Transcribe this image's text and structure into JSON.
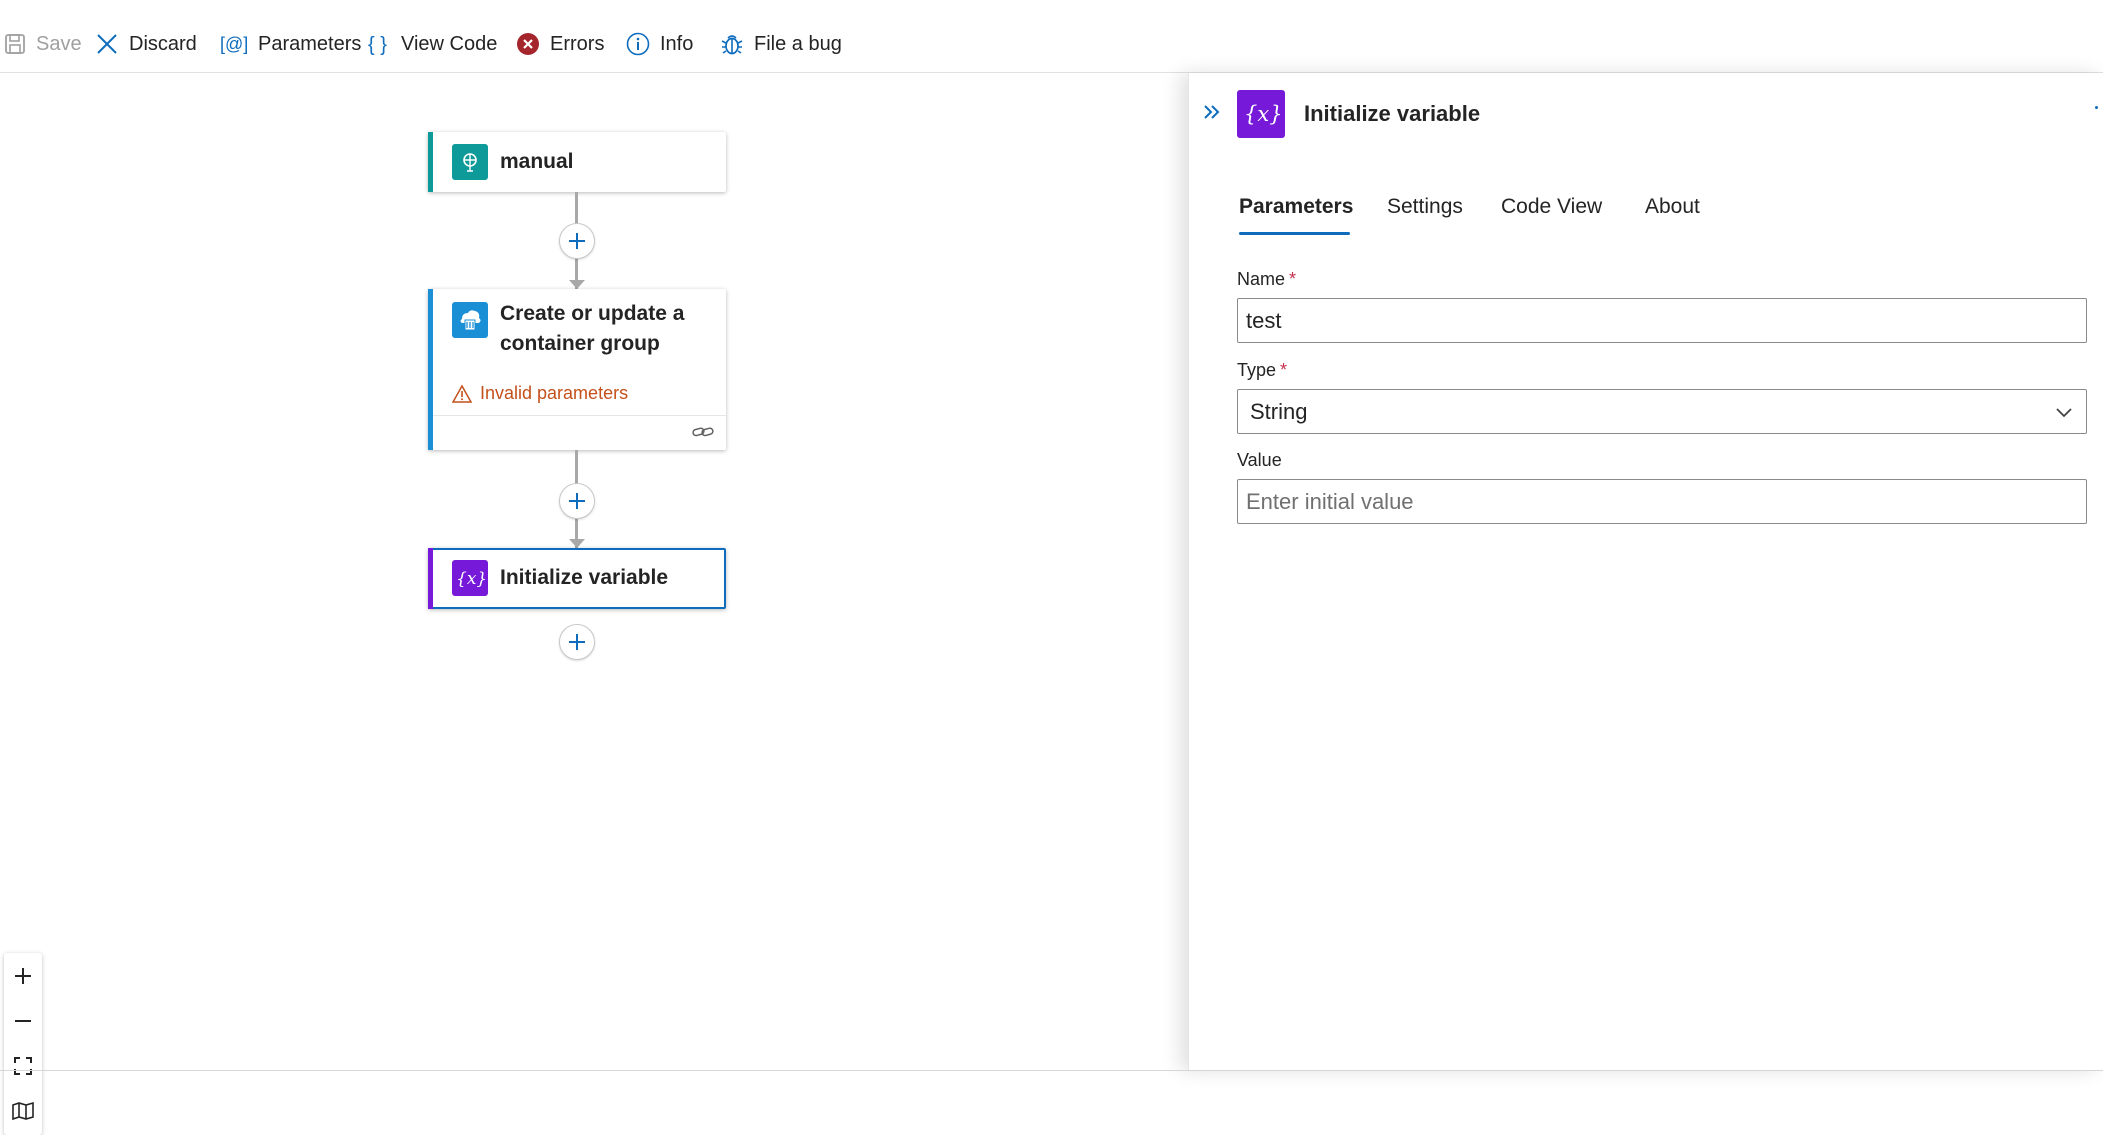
{
  "toolbar": {
    "save": "Save",
    "discard": "Discard",
    "parameters": "Parameters",
    "view_code": "View Code",
    "errors": "Errors",
    "info": "Info",
    "file_bug": "File a bug"
  },
  "nodes": {
    "trigger": {
      "title": "manual",
      "icon": "http-request-icon",
      "color": "#0f9a9a"
    },
    "container": {
      "title_line1": "Create or update a",
      "title_line2": "container group",
      "warning": "Invalid parameters",
      "icon": "container-instances-icon",
      "color": "#1a8fd6"
    },
    "variable": {
      "title": "Initialize variable",
      "icon": "variable-icon",
      "color": "#7719d8"
    }
  },
  "zoom_controls": [
    "zoom-in",
    "zoom-out",
    "fit-view",
    "minimap"
  ],
  "panel": {
    "title": "Initialize variable",
    "tabs": [
      "Parameters",
      "Settings",
      "Code View",
      "About"
    ],
    "active_tab": "Parameters",
    "fields": {
      "name_label": "Name",
      "name_value": "test",
      "type_label": "Type",
      "type_value": "String",
      "value_label": "Value",
      "value_placeholder": "Enter initial value",
      "required_marker": "*"
    }
  },
  "colors": {
    "accent": "#0f6cbd",
    "error": "#a4262c",
    "warning": "#c4501b",
    "variable": "#7719d8"
  }
}
